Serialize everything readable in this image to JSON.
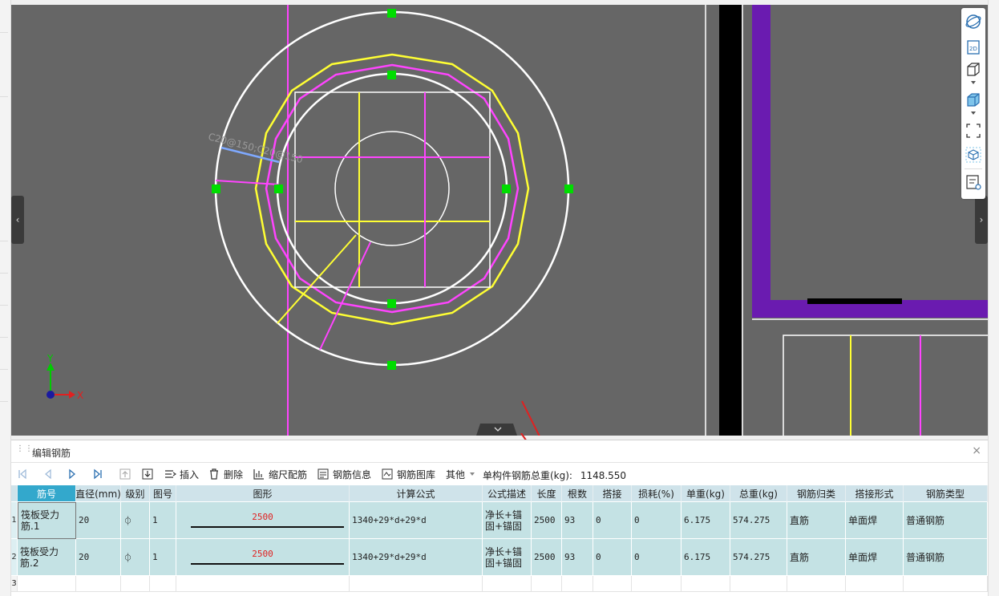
{
  "viewport": {
    "annotation": "C20@150;C20@150",
    "axis_x": "X",
    "axis_y": "Y"
  },
  "panel": {
    "title": "编辑钢筋",
    "close": "×"
  },
  "toolbar": {
    "insert": "插入",
    "delete": "删除",
    "scale_rebar": "缩尺配筋",
    "rebar_info": "钢筋信息",
    "rebar_library": "钢筋图库",
    "other": "其他",
    "total_weight_label": "单构件钢筋总重(kg):",
    "total_weight_value": "1148.550"
  },
  "table": {
    "headers": [
      "筋号",
      "直径(mm)",
      "级别",
      "图号",
      "图形",
      "计算公式",
      "公式描述",
      "长度",
      "根数",
      "搭接",
      "损耗(%)",
      "单重(kg)",
      "总重(kg)",
      "钢筋归类",
      "搭接形式",
      "钢筋类型"
    ],
    "rows": [
      {
        "row_no": "1",
        "name": "筏板受力筋.1",
        "diameter": "20",
        "grade": "⏀",
        "fig_no": "1",
        "shape_len": "2500",
        "formula": "1340+29*d+29*d",
        "formula_desc": "净长+锚固+锚固",
        "length": "2500",
        "count": "93",
        "lap": "0",
        "loss": "0",
        "unit_weight": "6.175",
        "total_weight": "574.275",
        "category": "直筋",
        "lap_type": "单面焊",
        "rebar_type": "普通钢筋"
      },
      {
        "row_no": "2",
        "name": "筏板受力筋.2",
        "diameter": "20",
        "grade": "⏀",
        "fig_no": "1",
        "shape_len": "2500",
        "formula": "1340+29*d+29*d",
        "formula_desc": "净长+锚固+锚固",
        "length": "2500",
        "count": "93",
        "lap": "0",
        "loss": "0",
        "unit_weight": "6.175",
        "total_weight": "574.275",
        "category": "直筋",
        "lap_type": "单面焊",
        "rebar_type": "普通钢筋"
      }
    ],
    "empty_row_no": "3"
  },
  "colors": {
    "viewport_bg": "#666666",
    "rebar_yellow": "#ffff33",
    "rebar_magenta": "#ff44ff",
    "handle_green": "#00dd00",
    "wall_purple": "#6a1bb0",
    "row_bg": "#c4e2e4",
    "header_bg": "#cfe3ea",
    "header_selected": "#33a8cc",
    "arrow_red": "#e02020"
  }
}
